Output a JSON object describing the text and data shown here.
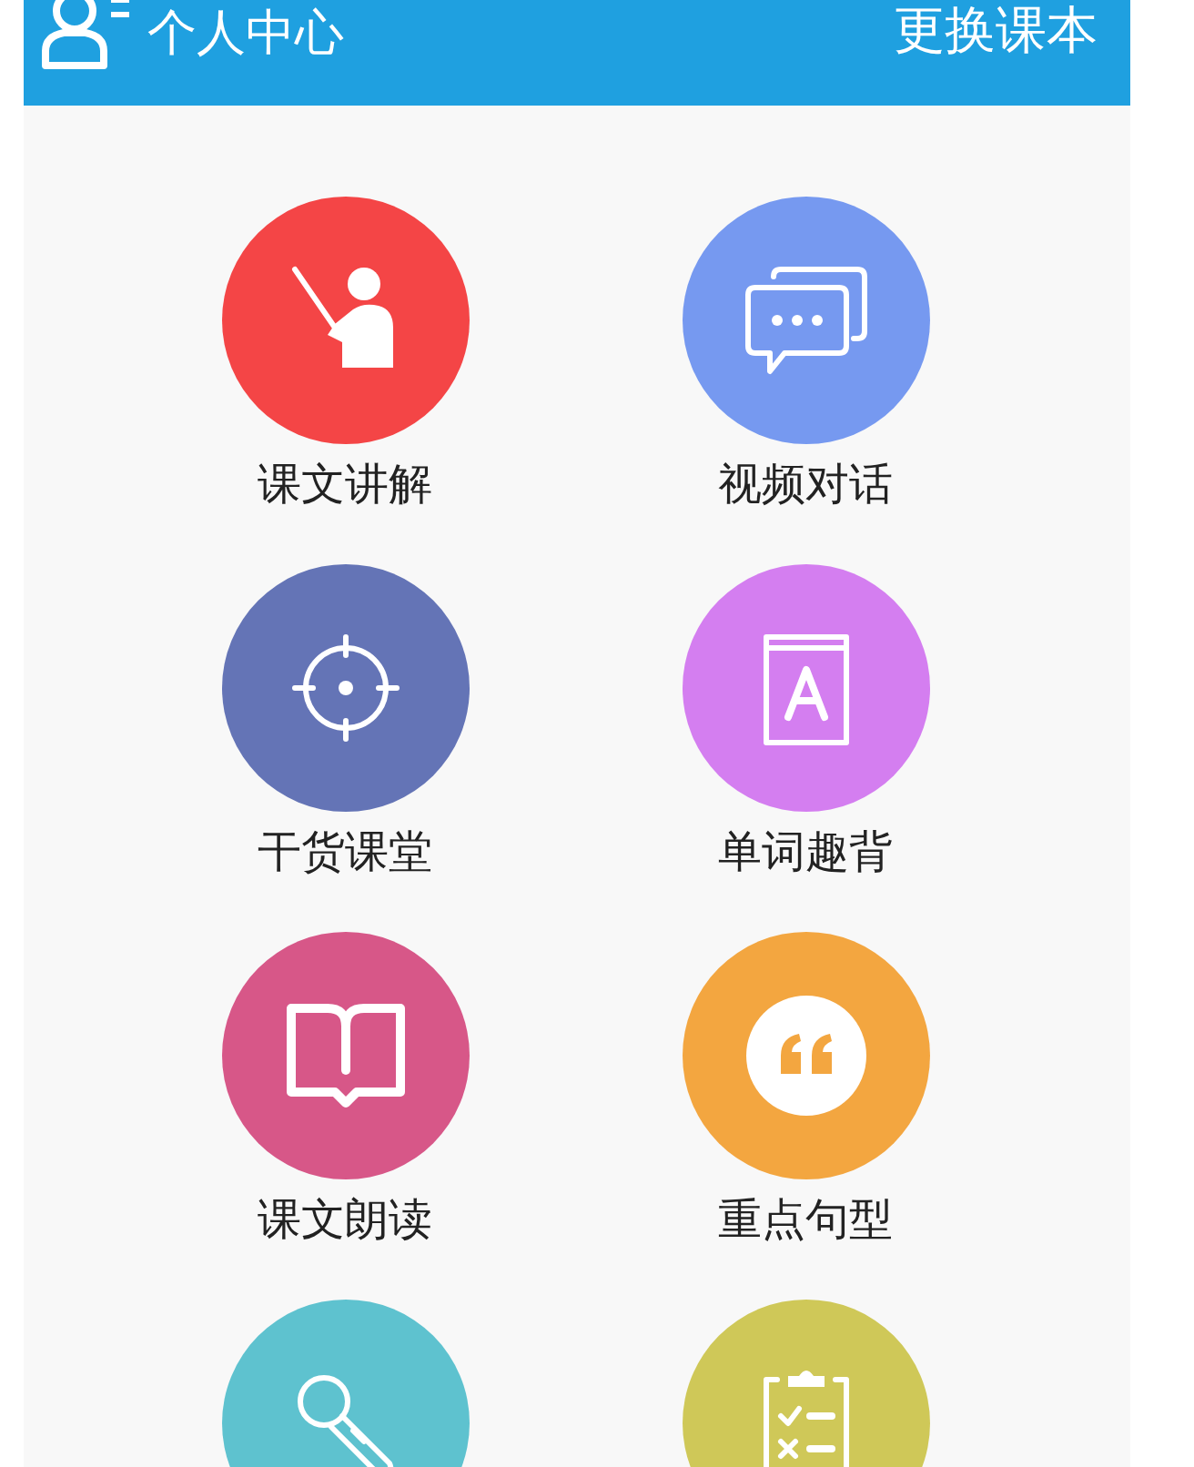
{
  "header": {
    "profile_label": "个人中心",
    "change_book_label": "更换课本"
  },
  "features": [
    {
      "kind": "teacher",
      "label": "课文讲解",
      "color": "#f44546"
    },
    {
      "kind": "chat",
      "label": "视频对话",
      "color": "#7699f0"
    },
    {
      "kind": "target",
      "label": "干货课堂",
      "color": "#6474b6"
    },
    {
      "kind": "book-a",
      "label": "单词趣背",
      "color": "#d47ef0"
    },
    {
      "kind": "book-open",
      "label": "课文朗读",
      "color": "#d75788"
    },
    {
      "kind": "quote",
      "label": "重点句型",
      "color": "#f3a640"
    },
    {
      "kind": "microphone",
      "color": "#5ec2cf"
    },
    {
      "kind": "clipboard",
      "color": "#cfc858"
    }
  ]
}
